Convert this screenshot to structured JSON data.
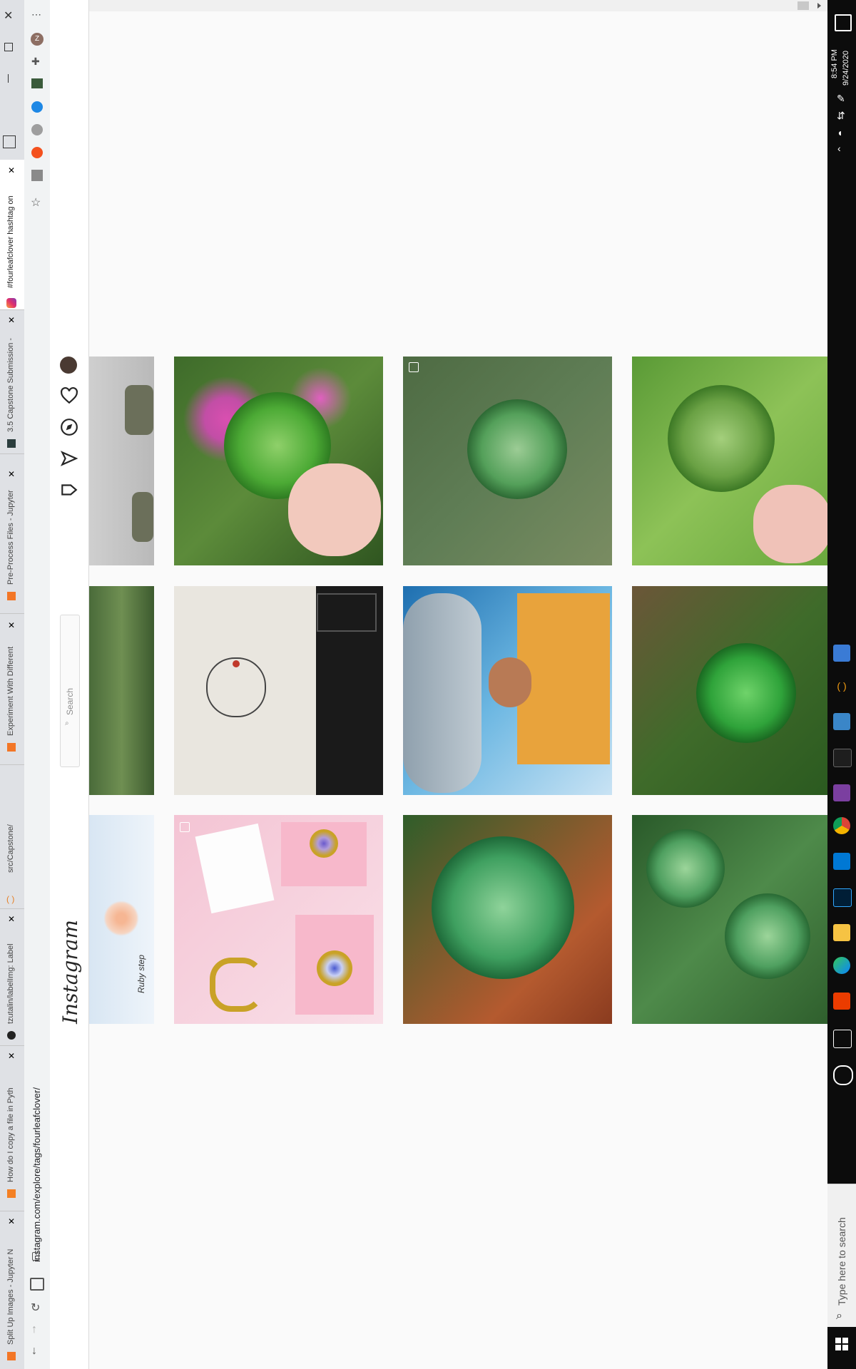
{
  "taskbar": {
    "time": "8:54 PM",
    "date": "9/24/2020",
    "search_placeholder": "Type here to search"
  },
  "browser": {
    "tabs": [
      {
        "label": "Split Up Images - Jupyter N"
      },
      {
        "label": "How do I copy a file in Pyth"
      },
      {
        "label": "tzutalin/labelImg: Label"
      },
      {
        "label": "src/Capstone/"
      },
      {
        "label": "Experiment With Different"
      },
      {
        "label": "Pre-Process Files - Jupyter"
      },
      {
        "label": "3.5 Capstone Submission -"
      },
      {
        "label": "#fourleafclover hashtag on"
      }
    ],
    "address": "instagram.com/explore/tags/fourleafclover/"
  },
  "instagram": {
    "logo": "Instagram",
    "search_placeholder": "Search"
  },
  "photos": [
    {
      "name": "photo-partial-legs",
      "desc": "partial"
    },
    {
      "name": "photo-clover-pink-flowers"
    },
    {
      "name": "photo-clover-ground"
    },
    {
      "name": "photo-clover-held-grass"
    },
    {
      "name": "photo-partial-grass"
    },
    {
      "name": "photo-clover-tattoo"
    },
    {
      "name": "photo-ufo-man"
    },
    {
      "name": "photo-clover-dark-grass"
    },
    {
      "name": "photo-partial-flower-drawing",
      "text": "Ruby step"
    },
    {
      "name": "photo-pink-pouches"
    },
    {
      "name": "photo-clover-red-leaves"
    },
    {
      "name": "photo-clover-patch"
    }
  ],
  "colors": {
    "taskbar": "#0c0c0c",
    "ig_background": "#fafafa",
    "clover_green": "#3f9a36"
  }
}
